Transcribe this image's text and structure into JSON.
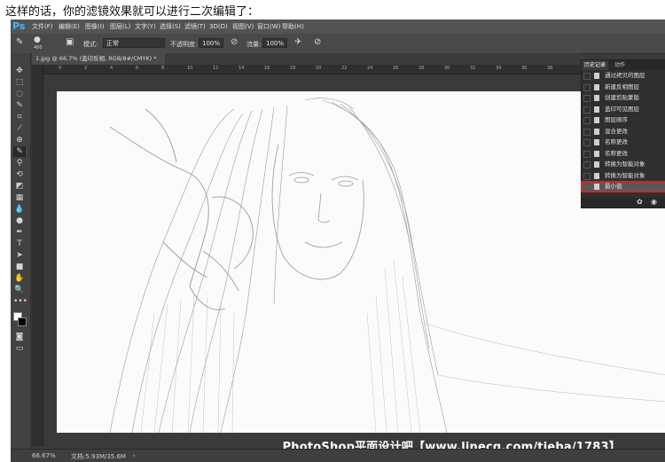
{
  "caption": "这样的话，你的滤镜效果就可以进行二次编辑了：",
  "app": {
    "logo": "Ps",
    "menus": [
      "文件(F)",
      "编辑(E)",
      "图像(I)",
      "图层(L)",
      "文字(Y)",
      "选择(S)",
      "滤镜(T)",
      "3D(D)",
      "视图(V)",
      "窗口(W)",
      "帮助(H)"
    ]
  },
  "options": {
    "brush_size": "400",
    "mode_label": "模式:",
    "mode_value": "正常",
    "opacity_label": "不透明度:",
    "opacity_value": "100%",
    "flow_label": "流量:",
    "flow_value": "100%"
  },
  "document_tab": "1.jpg @ 66.7% (盖印反相, RGB/8#/CMYK) *",
  "ruler_ticks": [
    "0",
    "2",
    "4",
    "6",
    "8",
    "10",
    "12",
    "14",
    "16",
    "18",
    "20",
    "22",
    "24",
    "26",
    "28",
    "30",
    "32",
    "34",
    "36",
    "38"
  ],
  "history_panel": {
    "tabs": [
      "历史记录",
      "动作"
    ],
    "items": [
      "通过拷贝的图层",
      "新建反相图层",
      "创建剪贴蒙版",
      "盖印可见图层",
      "图层顺序",
      "混合更改",
      "名称更改",
      "名称更改",
      "转换为智能对象",
      "转换为智能对象",
      "最小值"
    ],
    "selected_index": 10,
    "highlight_color": "#e02020"
  },
  "status": {
    "zoom": "66.67%",
    "doc_size": "文档:5.93M/35.6M"
  },
  "watermark": "PhotoShop平面设计吧【www.linecg.com/tieba/1783】"
}
